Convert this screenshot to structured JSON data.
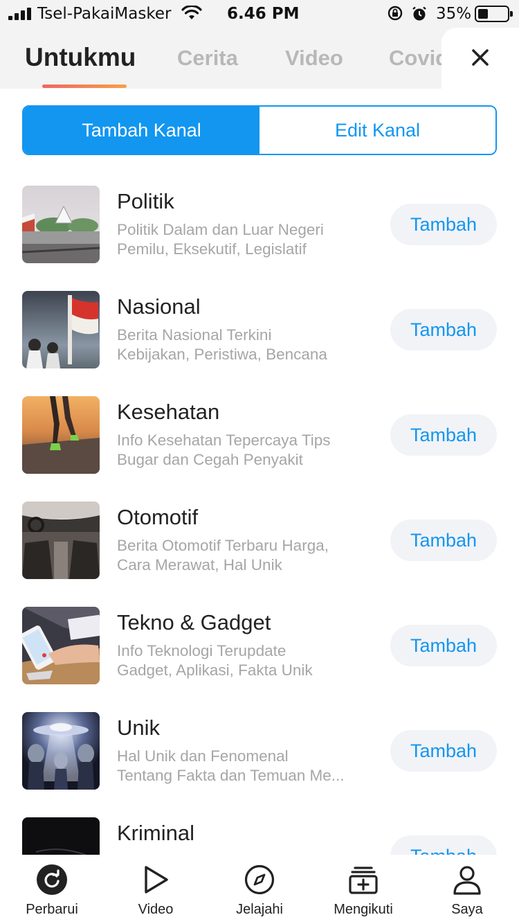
{
  "status_bar": {
    "carrier": "Tsel-PakaiMasker",
    "time": "6.46 PM",
    "battery": "35%",
    "battery_level": 0.35
  },
  "top_tabs": [
    {
      "label": "Untukmu",
      "active": true
    },
    {
      "label": "Cerita",
      "active": false
    },
    {
      "label": "Video",
      "active": false
    },
    {
      "label": "Covid",
      "active": false
    }
  ],
  "segmented": {
    "add_label": "Tambah Kanal",
    "edit_label": "Edit Kanal"
  },
  "channels": [
    {
      "title": "Politik",
      "desc1": "Politik Dalam dan Luar Negeri",
      "desc2": "Pemilu, Eksekutif, Legislatif",
      "button": "Tambah",
      "thumb_icon": "parliament-photo"
    },
    {
      "title": "Nasional",
      "desc1": "Berita Nasional Terkini",
      "desc2": "Kebijakan, Peristiwa, Bencana",
      "button": "Tambah",
      "thumb_icon": "monument-flag-photo"
    },
    {
      "title": "Kesehatan",
      "desc1": "Info Kesehatan Tepercaya Tips",
      "desc2": "Bugar dan Cegah Penyakit",
      "button": "Tambah",
      "thumb_icon": "runner-photo"
    },
    {
      "title": "Otomotif",
      "desc1": "Berita Otomotif Terbaru Harga,",
      "desc2": "Cara Merawat, Hal Unik",
      "button": "Tambah",
      "thumb_icon": "car-interior-photo"
    },
    {
      "title": "Tekno & Gadget",
      "desc1": "Info Teknologi Terupdate",
      "desc2": "Gadget, Aplikasi, Fakta Unik",
      "button": "Tambah",
      "thumb_icon": "smartphone-photo"
    },
    {
      "title": "Unik",
      "desc1": "Hal Unik dan Fenomenal",
      "desc2": "Tentang Fakta dan Temuan Me...",
      "button": "Tambah",
      "thumb_icon": "ufo-aliens-photo"
    },
    {
      "title": "Kriminal",
      "desc1": "",
      "desc2": "",
      "button": "Tambah",
      "thumb_icon": "dark-scene-photo"
    }
  ],
  "bottom_nav": [
    {
      "label": "Perbarui",
      "icon": "refresh-icon"
    },
    {
      "label": "Video",
      "icon": "play-icon"
    },
    {
      "label": "Jelajahi",
      "icon": "compass-icon"
    },
    {
      "label": "Mengikuti",
      "icon": "following-icon"
    },
    {
      "label": "Saya",
      "icon": "profile-icon"
    }
  ],
  "colors": {
    "accent": "#1296f0",
    "tab_indicator_start": "#f2655f",
    "tab_indicator_end": "#f6a049",
    "button_bg": "#f1f3f7",
    "muted_text": "#a6a6a6"
  }
}
